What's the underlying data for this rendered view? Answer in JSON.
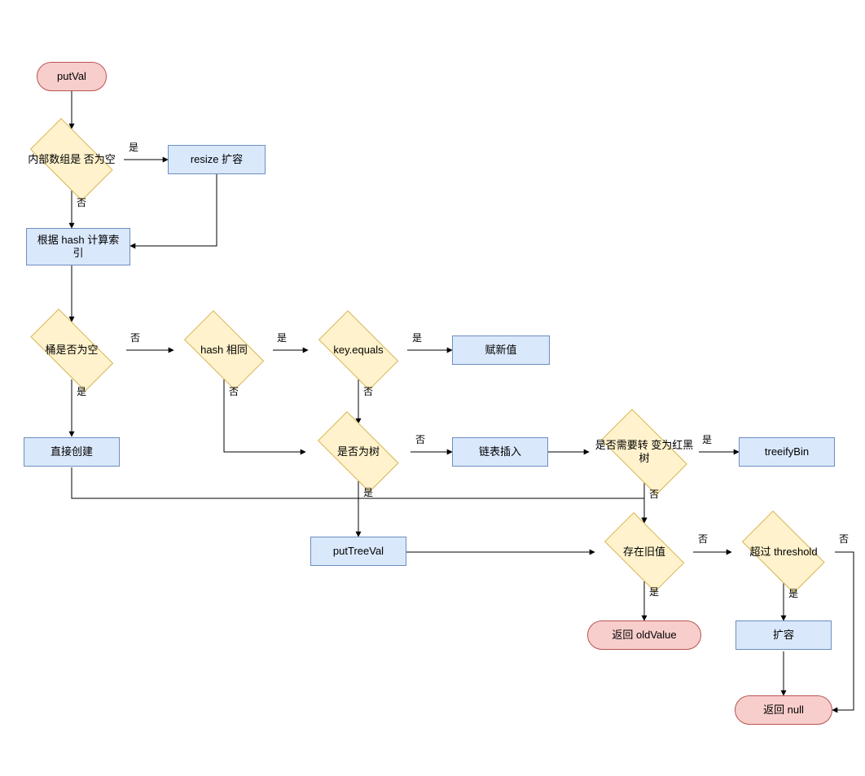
{
  "diagram": {
    "title": "putVal flowchart",
    "yes": "是",
    "no": "否",
    "nodes": {
      "start": "putVal",
      "array_empty": "内部数组是\n否为空",
      "resize1": "resize 扩容",
      "calc_index": "根据 hash\n计算索引",
      "bucket_empty": "桶是否为空",
      "direct_create": "直接创建",
      "hash_same": "hash 相同",
      "key_equals": "key.equals",
      "assign_new": "赋新值",
      "is_tree": "是否为树",
      "list_insert": "链表插入",
      "need_treeify": "是否需要转\n变为红黑树",
      "treeify": "treeifyBin",
      "puttreeval": "putTreeVal",
      "has_old": "存在旧值",
      "return_old": "返回 oldValue",
      "over_threshold": "超过\nthreshold",
      "resize2": "扩容",
      "return_null": "返回 null"
    }
  }
}
